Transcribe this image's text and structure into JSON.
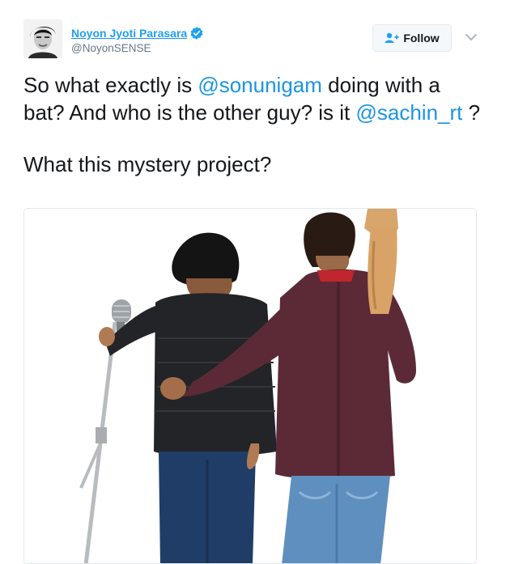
{
  "user": {
    "display_name": "Noyon Jyoti Parasara",
    "handle": "@NoyonSENSE",
    "verified": true,
    "avatar_icon": "profile-photo"
  },
  "actions": {
    "follow_label": "Follow",
    "follow_icon": "add-user-icon",
    "menu_icon": "chevron-down-icon"
  },
  "tweet": {
    "part1": "So what exactly is ",
    "mention1": "@sonunigam",
    "part2": " doing with a bat? And who is the other guy? is it ",
    "mention2": "@sachin_rt",
    "part3": " ?",
    "second_paragraph": "What this mystery project?"
  },
  "media": {
    "description_icon": "photo-two-men-with-bat-and-microphone"
  },
  "colors": {
    "link": "#1b95e0",
    "verified": "#1da1f2",
    "text": "#14171a",
    "muted": "#657786"
  }
}
